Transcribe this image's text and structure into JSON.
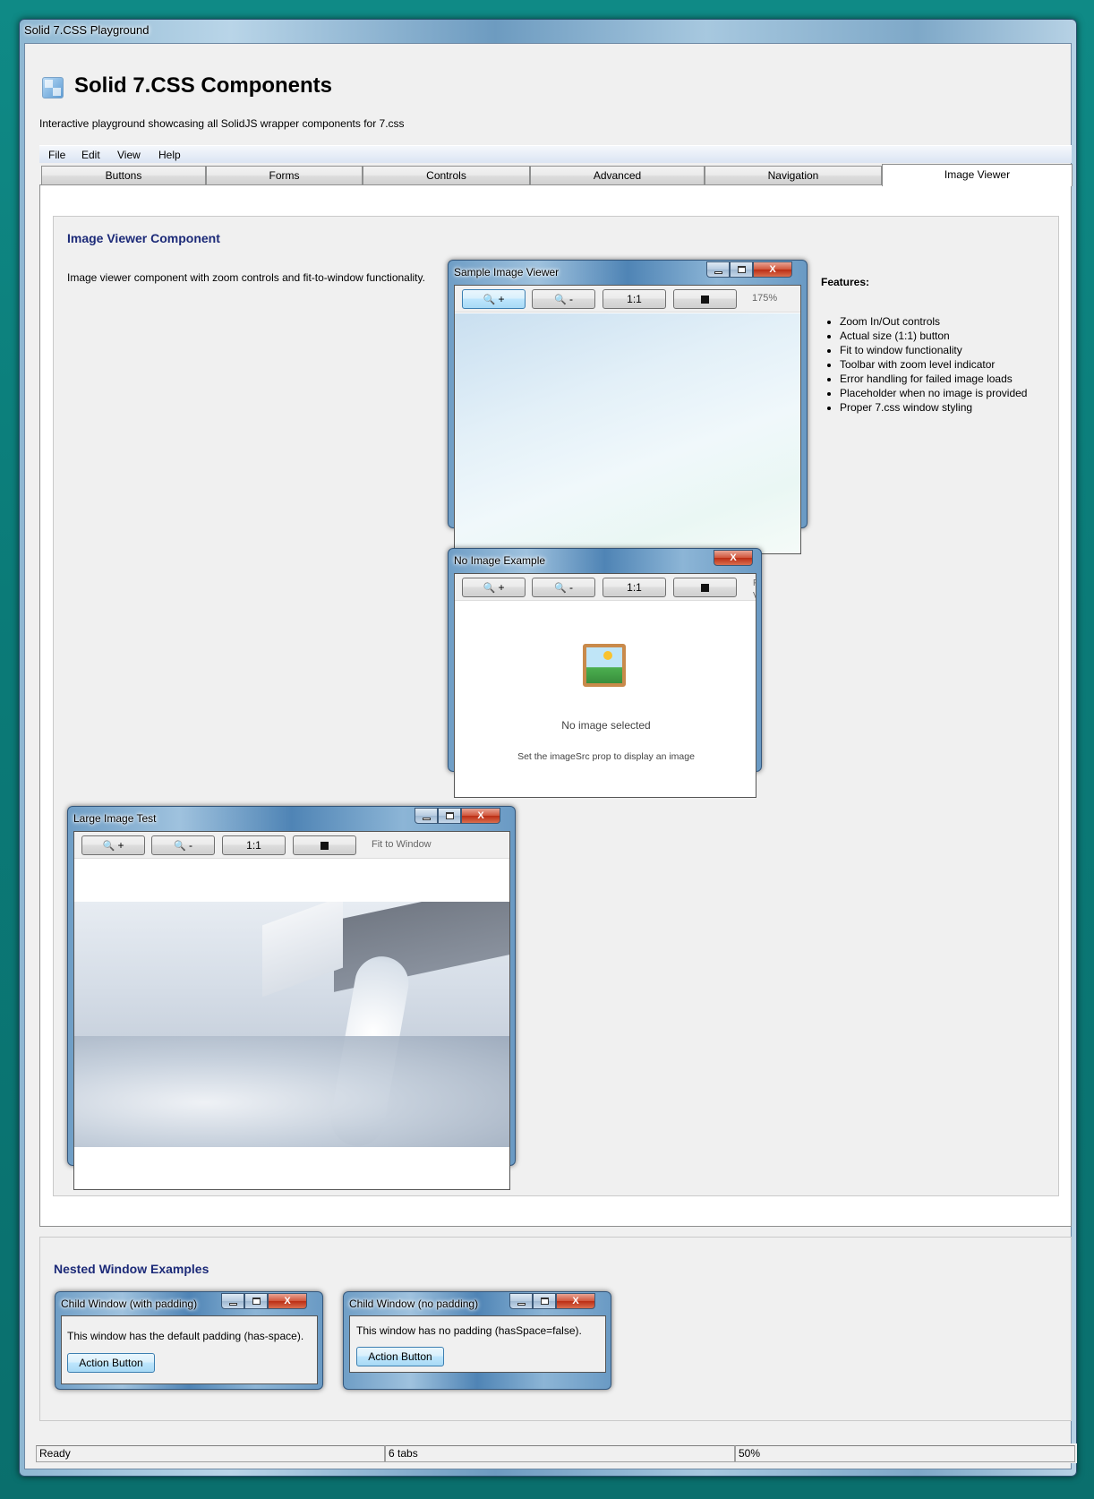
{
  "window": {
    "title": "Solid 7.CSS Playground"
  },
  "header": {
    "title": "Solid 7.CSS Components",
    "subtitle": "Interactive playground showcasing all SolidJS wrapper components for 7.css"
  },
  "menu": [
    "File",
    "Edit",
    "View",
    "Help"
  ],
  "tabs": [
    "Buttons",
    "Forms",
    "Controls",
    "Advanced",
    "Navigation",
    "Image Viewer"
  ],
  "active_tab": "Image Viewer",
  "image_viewer_section": {
    "title": "Image Viewer Component",
    "description": "Image viewer component with zoom controls and fit-to-window functionality.",
    "features_title": "Features:",
    "features": [
      "Zoom In/Out controls",
      "Actual size (1:1) button",
      "Fit to window functionality",
      "Toolbar with zoom level indicator",
      "Error handling for failed image loads",
      "Placeholder when no image is provided",
      "Proper 7.css window styling"
    ]
  },
  "toolbar_buttons": {
    "zoom_in": "+",
    "zoom_out": "-",
    "actual": "1:1",
    "zoom_glyph": "🔍"
  },
  "sample_viewer": {
    "title": "Sample Image Viewer",
    "zoom_level": "175%"
  },
  "no_image_viewer": {
    "title": "No Image Example",
    "placeholder_icon": "🖼️",
    "placeholder_title": "No image selected",
    "placeholder_hint": "Set the imageSrc prop to display an image",
    "clipped_text": "F\nV"
  },
  "large_viewer": {
    "title": "Large Image Test",
    "zoom_level": "Fit to Window"
  },
  "nested_section": {
    "title": "Nested Window Examples",
    "child_with_padding": {
      "title": "Child Window (with padding)",
      "text": "This window has the default padding (has-space).",
      "button": "Action Button"
    },
    "child_no_padding": {
      "title": "Child Window (no padding)",
      "text": "This window has no padding (hasSpace=false).",
      "button": "Action Button"
    }
  },
  "status": [
    "Ready",
    "6 tabs",
    "50%"
  ],
  "window_controls": {
    "close": "X"
  },
  "colors": {
    "accent": "#1c2a78",
    "desktop": "#0f8a86",
    "panel": "#f0f0f0"
  }
}
